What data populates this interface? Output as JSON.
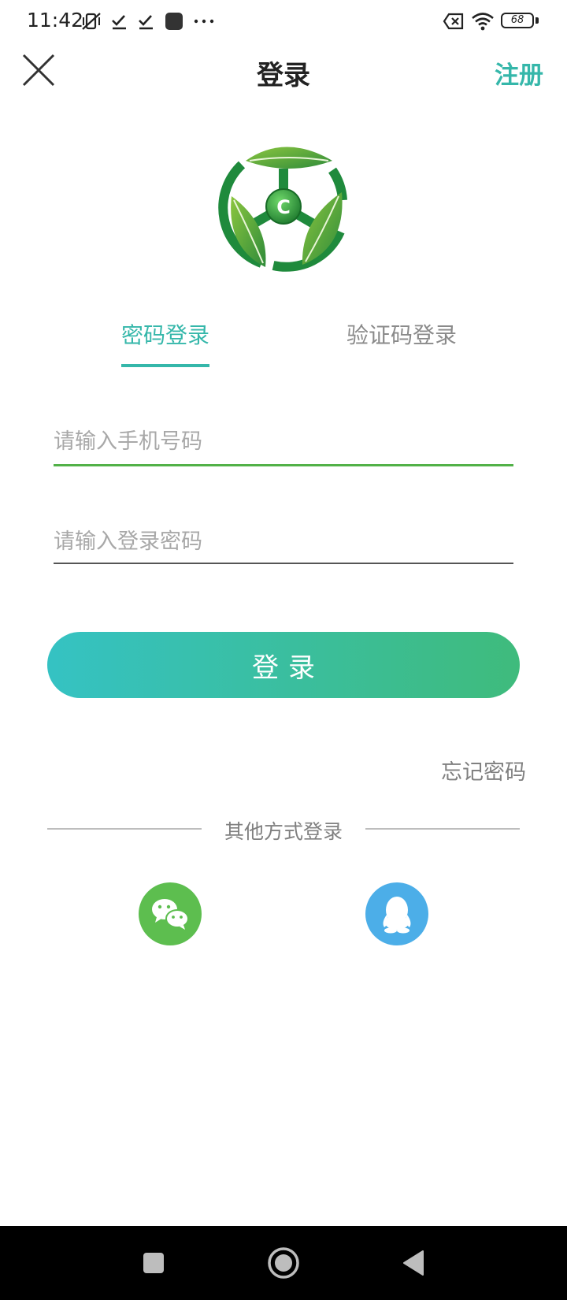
{
  "status_bar": {
    "time": "11:42",
    "battery": "68",
    "icons": [
      "vibrate-off-icon",
      "check-icon",
      "check-icon",
      "app-square-icon",
      "more-dots-icon",
      "sim-off-icon",
      "wifi-icon",
      "battery-icon"
    ]
  },
  "header": {
    "title": "登录",
    "register_label": "注册",
    "close_icon": "close-icon"
  },
  "logo": {
    "letter": "C",
    "icon": "leaf-logo-icon"
  },
  "tabs": [
    {
      "label": "密码登录",
      "active": true
    },
    {
      "label": "验证码登录",
      "active": false
    }
  ],
  "form": {
    "phone_placeholder": "请输入手机号码",
    "password_placeholder": "请输入登录密码",
    "login_label": "登录",
    "forgot_label": "忘记密码"
  },
  "other_login": {
    "label": "其他方式登录",
    "providers": [
      {
        "icon": "wechat-icon"
      },
      {
        "icon": "qq-icon"
      }
    ]
  },
  "colors": {
    "accent": "#35b7aa",
    "input_focus": "#52b148",
    "button_gradient_start": "#35c2c3",
    "button_gradient_end": "#3fbb7c",
    "wechat": "#5dbe4f",
    "qq": "#4caee8"
  }
}
